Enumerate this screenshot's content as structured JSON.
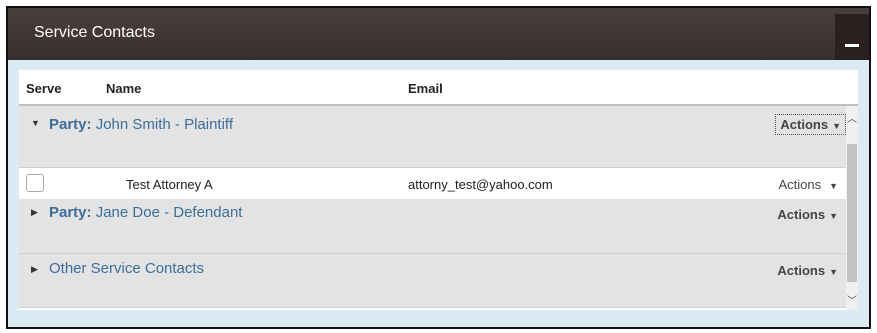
{
  "panel": {
    "title": "Service Contacts"
  },
  "table": {
    "headers": {
      "serve": "Serve",
      "name": "Name",
      "email": "Email"
    }
  },
  "groups": [
    {
      "prefix": "Party:",
      "label": " John Smith - Plaintiff",
      "expanded": true,
      "actions": "Actions"
    },
    {
      "prefix": "Party:",
      "label": " Jane Doe - Defendant",
      "expanded": false,
      "actions": "Actions"
    },
    {
      "prefix": "",
      "label": "Other Service Contacts",
      "expanded": false,
      "actions": "Actions"
    }
  ],
  "contacts": [
    {
      "name": "Test Attorney A",
      "email": "attorny_test@yahoo.com",
      "actions": "Actions",
      "checked": false
    }
  ],
  "icons": {
    "expanded": "caret-down-icon",
    "collapsed": "caret-right-icon",
    "dropdown": "triangle-down-icon",
    "collapse": "minus-icon",
    "scroll_up": "chevron-up-icon",
    "scroll_down": "chevron-down-icon"
  },
  "colors": {
    "titlebar": "#3f3434",
    "link": "#3c6e9a",
    "group_bg": "#e3e3e3",
    "outer_bg": "#dceaf3"
  }
}
